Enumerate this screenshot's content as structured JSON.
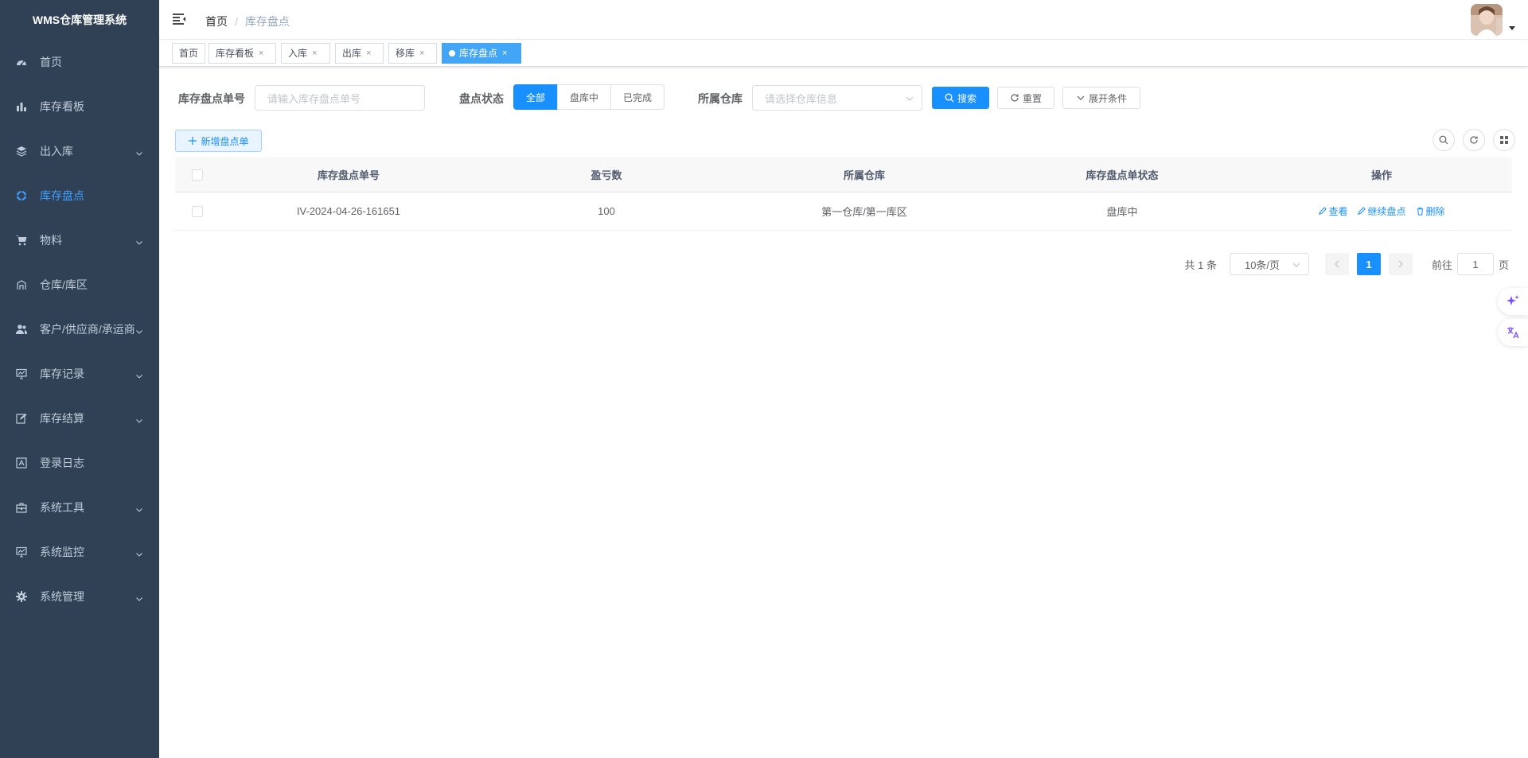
{
  "app": {
    "title": "WMS仓库管理系统"
  },
  "sidebar": {
    "items": [
      {
        "label": "首页",
        "icon": "dashboard-icon",
        "active": false,
        "hasChildren": false
      },
      {
        "label": "库存看板",
        "icon": "bar-chart-icon",
        "active": false,
        "hasChildren": false
      },
      {
        "label": "出入库",
        "icon": "layers-icon",
        "active": false,
        "hasChildren": true
      },
      {
        "label": "库存盘点",
        "icon": "target-icon",
        "active": true,
        "hasChildren": false
      },
      {
        "label": "物料",
        "icon": "cart-icon",
        "active": false,
        "hasChildren": true
      },
      {
        "label": "仓库/库区",
        "icon": "warehouse-icon",
        "active": false,
        "hasChildren": false
      },
      {
        "label": "客户/供应商/承运商",
        "icon": "people-icon",
        "active": false,
        "hasChildren": true
      },
      {
        "label": "库存记录",
        "icon": "monitor-icon",
        "active": false,
        "hasChildren": true
      },
      {
        "label": "库存结算",
        "icon": "edit-icon",
        "active": false,
        "hasChildren": true
      },
      {
        "label": "登录日志",
        "icon": "log-icon",
        "active": false,
        "hasChildren": false
      },
      {
        "label": "系统工具",
        "icon": "toolbox-icon",
        "active": false,
        "hasChildren": true
      },
      {
        "label": "系统监控",
        "icon": "monitor-icon",
        "active": false,
        "hasChildren": true
      },
      {
        "label": "系统管理",
        "icon": "gear-icon",
        "active": false,
        "hasChildren": true
      }
    ]
  },
  "navbar": {
    "breadcrumb": {
      "home": "首页",
      "separator": "/",
      "current": "库存盘点"
    }
  },
  "tags": [
    {
      "label": "首页",
      "closable": false,
      "active": false
    },
    {
      "label": "库存看板",
      "closable": true,
      "active": false
    },
    {
      "label": "入库",
      "closable": true,
      "active": false
    },
    {
      "label": "出库",
      "closable": true,
      "active": false
    },
    {
      "label": "移库",
      "closable": true,
      "active": false
    },
    {
      "label": "库存盘点",
      "closable": true,
      "active": true
    }
  ],
  "filter": {
    "order_no_label": "库存盘点单号",
    "order_no_placeholder": "请输入库存盘点单号",
    "status_label": "盘点状态",
    "status_options": [
      "全部",
      "盘库中",
      "已完成"
    ],
    "status_selected": "全部",
    "warehouse_label": "所属仓库",
    "warehouse_placeholder": "请选择仓库信息",
    "search_label": "搜索",
    "reset_label": "重置",
    "expand_label": "展开条件"
  },
  "toolbar": {
    "add_label": "新增盘点单"
  },
  "table": {
    "columns": [
      "库存盘点单号",
      "盈亏数",
      "所属仓库",
      "库存盘点单状态",
      "操作"
    ],
    "rows": [
      {
        "order_no": "IV-2024-04-26-161651",
        "profit_loss": "100",
        "warehouse": "第一仓库/第一库区",
        "status": "盘库中"
      }
    ],
    "actions": {
      "view": "查看",
      "continue": "继续盘点",
      "delete": "删除"
    }
  },
  "pagination": {
    "total": "共 1 条",
    "page_size": "10条/页",
    "current_page": "1",
    "goto_prefix": "前往",
    "goto_value": "1",
    "goto_suffix": "页"
  },
  "colors": {
    "sidebar_bg": "#304156",
    "primary": "#1890ff",
    "active_menu": "#409eff",
    "active_tag": "#42a5f5"
  }
}
